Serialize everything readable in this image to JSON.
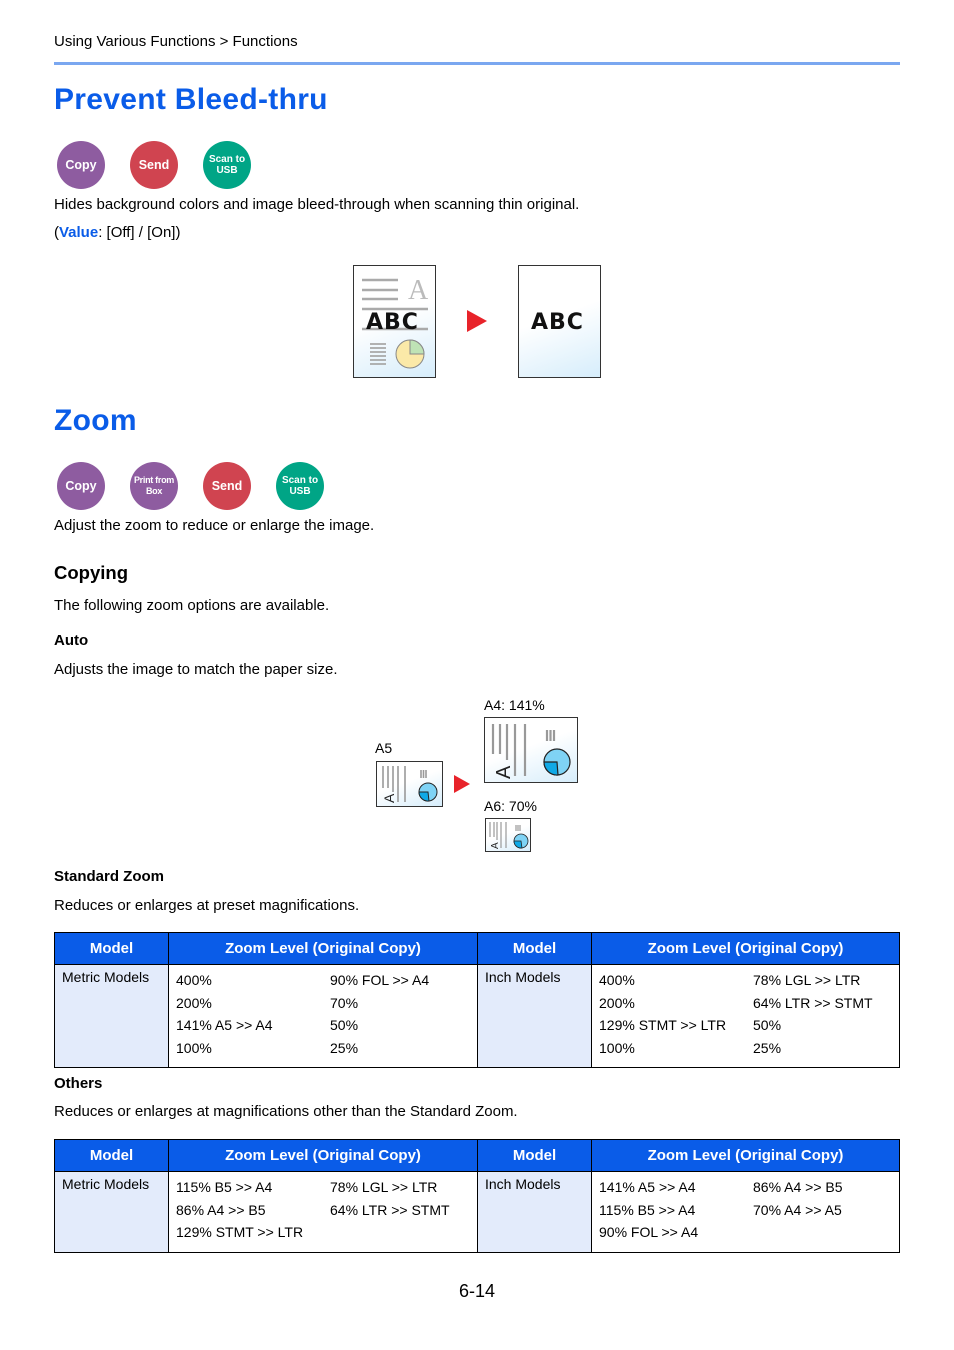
{
  "breadcrumb": "Using Various Functions > Functions",
  "sections": {
    "bleed": {
      "title": "Prevent Bleed-thru",
      "badges": [
        {
          "icon": "copy-mode-icon",
          "label": "Copy",
          "color": "#8e5ca0"
        },
        {
          "icon": "send-mode-icon",
          "label": "Send",
          "color": "#d04450"
        },
        {
          "icon": "scan-to-usb-icon",
          "label": "Scan to USB",
          "color": "#00a586"
        }
      ],
      "description": "Hides background colors and image bleed-through when scanning thin original.",
      "value_prefix": "(",
      "value_keyword": "Value",
      "value_text": ": [Off] / [On])",
      "illustration": {
        "before_text": "A B C",
        "before_faint_letter": "A",
        "after_text": "A B C"
      }
    },
    "zoom": {
      "title": "Zoom",
      "badges": [
        {
          "icon": "copy-mode-icon",
          "label": "Copy",
          "color": "#8e5ca0"
        },
        {
          "icon": "print-from-box-icon",
          "label": "Print from Box",
          "color": "#8e5ca0"
        },
        {
          "icon": "send-mode-icon",
          "label": "Send",
          "color": "#d04450"
        },
        {
          "icon": "scan-to-usb-icon",
          "label": "Scan to USB",
          "color": "#00a586"
        }
      ],
      "description": "Adjust the zoom to reduce or enlarge the image.",
      "copying": {
        "heading": "Copying",
        "intro": "The following zoom options are available.",
        "auto": {
          "heading": "Auto",
          "text": "Adjusts the image to match the paper size.",
          "illustration": {
            "source_label": "A5",
            "enlarge_label": "A4: 141%",
            "reduce_label": "A6: 70%",
            "doc_letter": "A"
          }
        },
        "standard": {
          "heading": "Standard Zoom",
          "text": "Reduces or enlarges at preset magnifications.",
          "table": {
            "headers": [
              "Model",
              "Zoom Level (Original Copy)",
              "Model",
              "Zoom Level (Original Copy)"
            ],
            "metric": {
              "model": "Metric Models",
              "col1": [
                "400%",
                "200%",
                "141% A5 >> A4",
                "100%"
              ],
              "col2": [
                "90% FOL >> A4",
                "70%",
                "50%",
                "25%"
              ]
            },
            "inch": {
              "model": "Inch Models",
              "col1": [
                "400%",
                "200%",
                "129% STMT >> LTR",
                "100%"
              ],
              "col2": [
                "78% LGL >> LTR",
                "64% LTR >> STMT",
                "50%",
                "25%"
              ]
            }
          }
        },
        "others": {
          "heading": "Others",
          "text": "Reduces or enlarges at magnifications other than the Standard Zoom.",
          "table": {
            "headers": [
              "Model",
              "Zoom Level (Original Copy)",
              "Model",
              "Zoom Level (Original Copy)"
            ],
            "metric": {
              "model": "Metric Models",
              "col1": [
                "115% B5 >> A4",
                "86% A4 >> B5",
                "129% STMT >> LTR"
              ],
              "col2": [
                "78% LGL >> LTR",
                "64% LTR >> STMT"
              ]
            },
            "inch": {
              "model": "Inch Models",
              "col1": [
                "141% A5 >> A4",
                "115% B5 >> A4",
                "90% FOL >> A4"
              ],
              "col2": [
                "86% A4 >> B5",
                "70% A4 >> A5"
              ]
            }
          }
        }
      }
    }
  },
  "page_number": "6-14",
  "colors": {
    "heading_blue": "#0a5ce8",
    "rule_blue": "#7aa7f0",
    "table_header_bg": "#0a5ce8",
    "model_cell_bg": "#e3ebfb",
    "arrow_red": "#e8232a"
  }
}
